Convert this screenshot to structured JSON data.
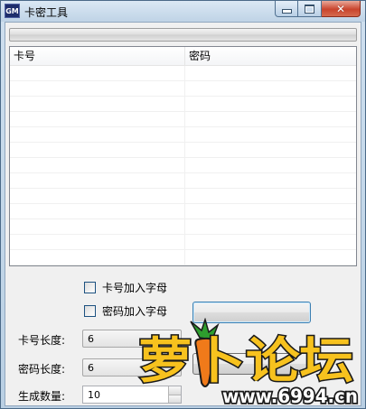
{
  "window": {
    "icon_text": "GM",
    "title": "卡密工具"
  },
  "progress": {
    "value": 0
  },
  "list": {
    "columns": [
      "卡号",
      "密码"
    ],
    "rows": []
  },
  "options": {
    "card_letters_label": "卡号加入字母",
    "card_letters_checked": false,
    "password_letters_label": "密码加入字母",
    "password_letters_checked": false
  },
  "form": {
    "card_length_label": "卡号长度:",
    "card_length_value": "6",
    "password_length_label": "密码长度:",
    "password_length_value": "6",
    "count_label": "生成数量:",
    "count_value": "10"
  },
  "buttons": {
    "generate_label": "",
    "save_label": ""
  },
  "watermark": {
    "brand_text": "萝卜论坛",
    "url_text": "www.6994.cn"
  },
  "colors": {
    "progress_fill": "#32b432",
    "watermark_fill": "#f7c21e",
    "watermark_stroke": "#1a1a1a",
    "carrot": "#f07a1a"
  }
}
